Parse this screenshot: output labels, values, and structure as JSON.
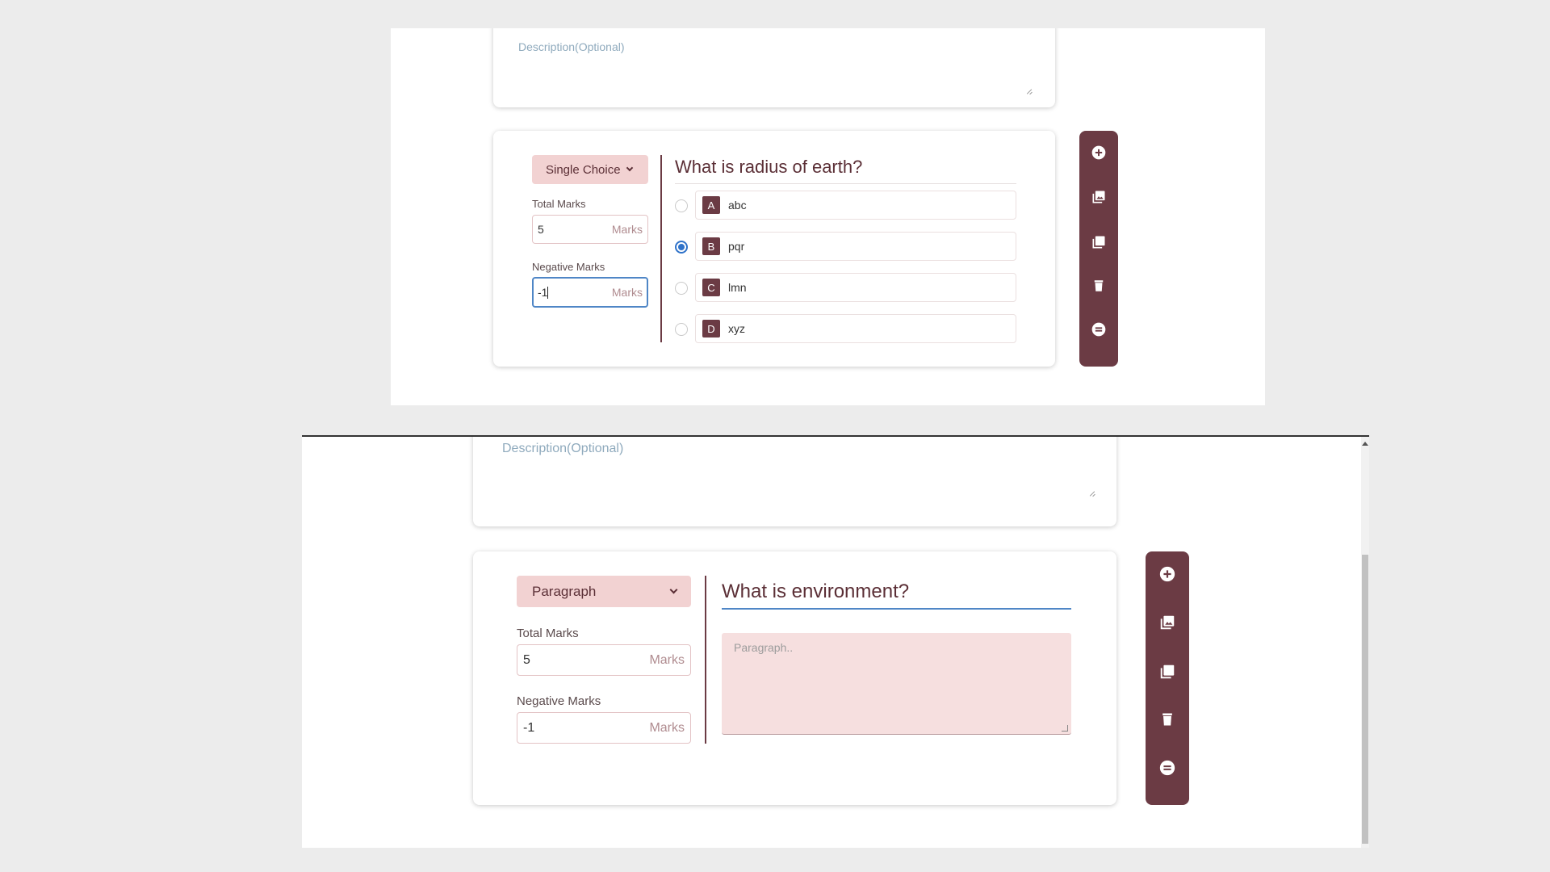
{
  "top": {
    "description_placeholder": "Description(Optional)",
    "question_type": "Single Choice",
    "total_marks_label": "Total Marks",
    "total_marks_value": "5",
    "negative_marks_label": "Negative Marks",
    "negative_marks_value": "-1",
    "marks_unit": "Marks",
    "question_title": "What is radius of earth?",
    "selected_option_index": 1,
    "options": [
      {
        "letter": "A",
        "text": "abc"
      },
      {
        "letter": "B",
        "text": "pqr"
      },
      {
        "letter": "C",
        "text": "lmn"
      },
      {
        "letter": "D",
        "text": "xyz"
      }
    ]
  },
  "bottom": {
    "description_placeholder": "Description(Optional)",
    "question_type": "Paragraph",
    "total_marks_label": "Total Marks",
    "total_marks_value": "5",
    "negative_marks_label": "Negative Marks",
    "negative_marks_value": "-1",
    "marks_unit": "Marks",
    "question_title": "What is environment?",
    "paragraph_placeholder": "Paragraph.."
  },
  "toolbar_icons": [
    "add-circle-icon",
    "image-icon",
    "copy-icon",
    "delete-icon",
    "section-icon"
  ],
  "colors": {
    "accent": "#6b3b44",
    "select_bg": "#f2d2d2",
    "paragraph_bg": "#f6dfdf",
    "radio_selected": "#2f72c9",
    "focus_border": "#4f86c6",
    "page_bg": "#ececec"
  }
}
